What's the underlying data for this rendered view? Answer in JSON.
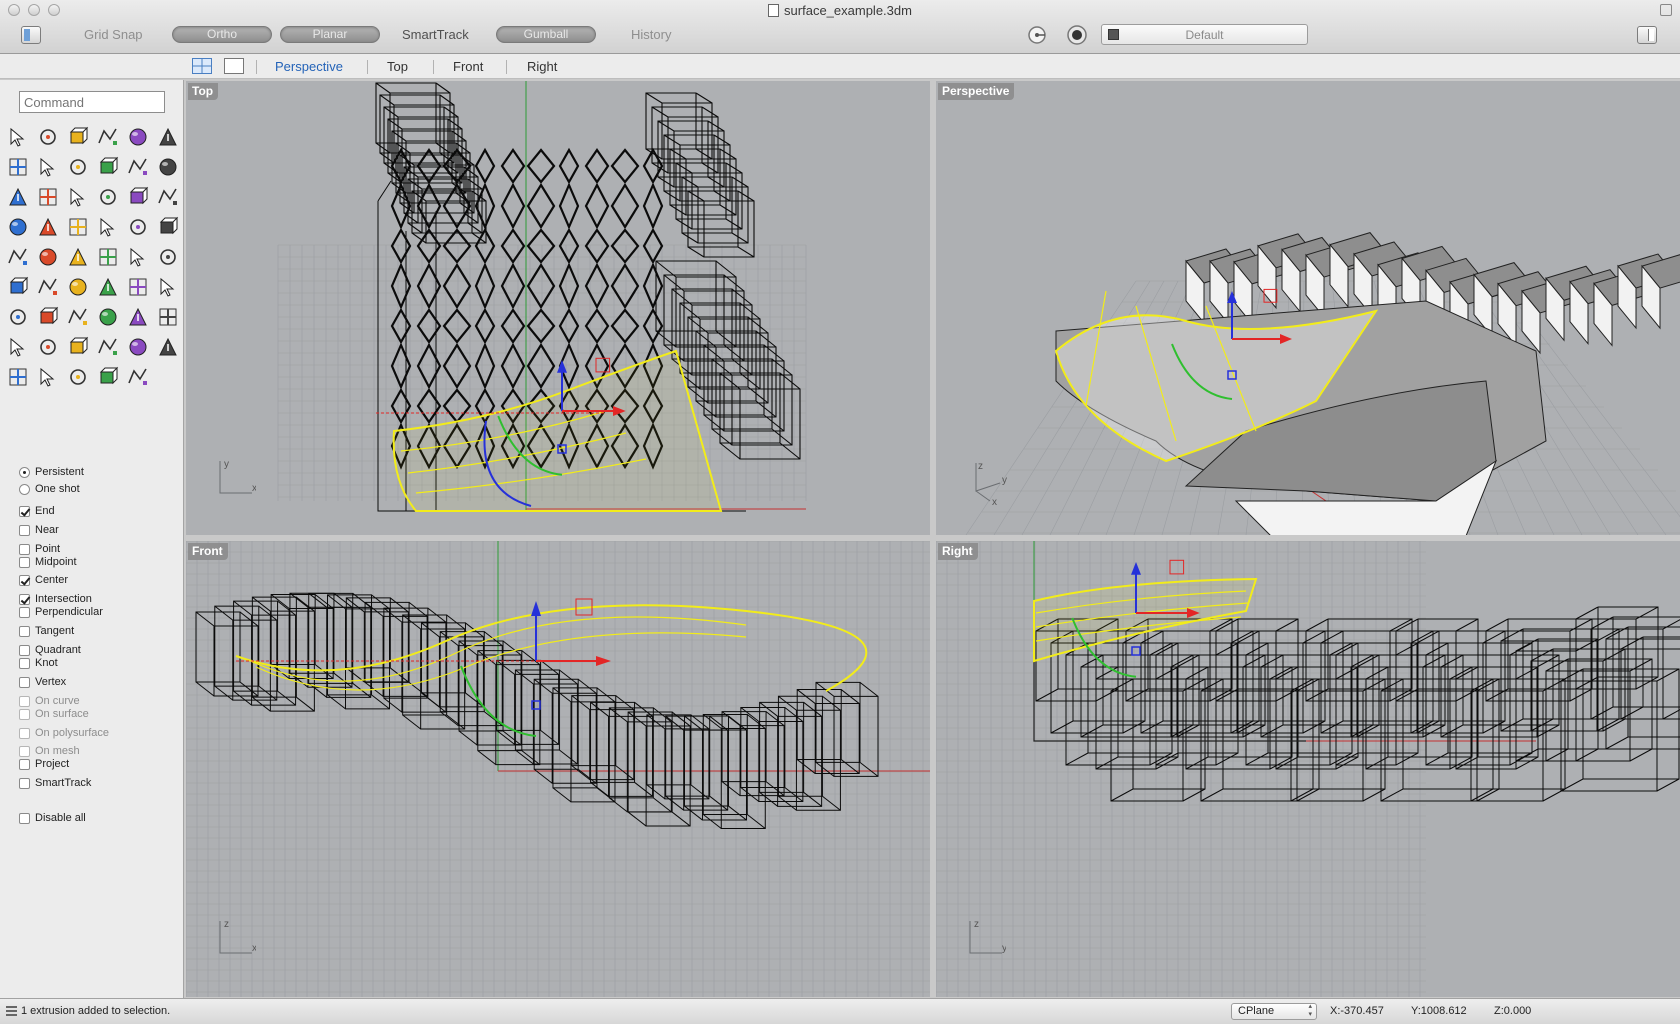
{
  "window": {
    "title": "surface_example.3dm"
  },
  "toolbar": {
    "grid_snap": "Grid Snap",
    "ortho": "Ortho",
    "planar": "Planar",
    "smarttrack": "SmartTrack",
    "gumball": "Gumball",
    "history": "History",
    "layer": "Default"
  },
  "view_tabs": [
    "Perspective",
    "Top",
    "Front",
    "Right"
  ],
  "command": {
    "placeholder": "Command"
  },
  "tool_icons": [
    "select-arrow-icon",
    "point-icon",
    "polyline-icon",
    "curve-icon",
    "circle-icon",
    "ellipse-icon",
    "polygon-icon",
    "rectangle-icon",
    "arc-icon",
    "fillet-icon",
    "surface-icon",
    "loft-icon",
    "box-icon",
    "sphere-icon",
    "cylinder-icon",
    "extrude-icon",
    "gear-icon",
    "flame-icon",
    "trim-icon",
    "split-icon",
    "boolean-icon",
    "group-icon",
    "join-icon",
    "rebuild-icon",
    "text-icon",
    "scale-icon",
    "array-icon",
    "transform-icon",
    "render-cube-icon",
    "dimension-icon",
    "grid-array-icon",
    "move-icon",
    "layer-icon",
    "check-icon",
    "material-icon",
    "paint-icon",
    "zoom-icon",
    "zoom-window-icon",
    "zoom-extents-icon",
    "zoom-selected-icon",
    "rotate-view-icon",
    "car-icon",
    "clip-icon",
    "properties-icon",
    "light-icon",
    "lock-icon",
    "shield-icon",
    "color-wheel-icon",
    "globe-icon",
    "mesh-icon",
    "blue-sphere-icon",
    "spotlight-icon",
    "snap-grid-icon"
  ],
  "osnaps": [
    {
      "label": "Persistent",
      "kind": "radio",
      "checked": true,
      "enabled": true
    },
    {
      "label": "One shot",
      "kind": "radio",
      "checked": false,
      "enabled": true
    },
    {
      "label": "End",
      "kind": "check",
      "checked": true,
      "enabled": true
    },
    {
      "label": "Near",
      "kind": "check",
      "checked": false,
      "enabled": true
    },
    {
      "label": "Point",
      "kind": "check",
      "checked": false,
      "enabled": true
    },
    {
      "label": "Midpoint",
      "kind": "check",
      "checked": false,
      "enabled": true
    },
    {
      "label": "Center",
      "kind": "check",
      "checked": true,
      "enabled": true
    },
    {
      "label": "Intersection",
      "kind": "check",
      "checked": true,
      "enabled": true
    },
    {
      "label": "Perpendicular",
      "kind": "check",
      "checked": false,
      "enabled": true
    },
    {
      "label": "Tangent",
      "kind": "check",
      "checked": false,
      "enabled": true
    },
    {
      "label": "Quadrant",
      "kind": "check",
      "checked": false,
      "enabled": true
    },
    {
      "label": "Knot",
      "kind": "check",
      "checked": false,
      "enabled": true
    },
    {
      "label": "Vertex",
      "kind": "check",
      "checked": false,
      "enabled": true
    },
    {
      "label": "On curve",
      "kind": "check",
      "checked": false,
      "enabled": false
    },
    {
      "label": "On surface",
      "kind": "check",
      "checked": false,
      "enabled": false
    },
    {
      "label": "On polysurface",
      "kind": "check",
      "checked": false,
      "enabled": false
    },
    {
      "label": "On mesh",
      "kind": "check",
      "checked": false,
      "enabled": false
    },
    {
      "label": "Project",
      "kind": "check",
      "checked": false,
      "enabled": true
    },
    {
      "label": "SmartTrack",
      "kind": "check",
      "checked": false,
      "enabled": true
    },
    {
      "label": "Disable all",
      "kind": "check",
      "checked": false,
      "enabled": true
    }
  ],
  "viewports": {
    "top": {
      "label": "Top",
      "axis_a": "y",
      "axis_b": "x"
    },
    "perspective": {
      "label": "Perspective",
      "axis_a": "z",
      "axis_b": "y",
      "axis_c": "x"
    },
    "front": {
      "label": "Front",
      "axis_a": "z",
      "axis_b": "x"
    },
    "right": {
      "label": "Right",
      "axis_a": "z",
      "axis_b": "y"
    }
  },
  "status": {
    "message": "1 extrusion added to selection.",
    "cplane": "CPlane",
    "x": "X:-370.457",
    "y": "Y:1008.612",
    "z": "Z:0.000"
  },
  "colors": {
    "viewport_bg": "#aeb0b3",
    "grid": "#9b9ea2",
    "wire": "#0b0b0b",
    "selection": "#f2ec1a",
    "gumball_x": "#e32626",
    "gumball_y": "#2fbf2f",
    "gumball_z": "#2631d9",
    "active_tab": "#2463b8"
  }
}
